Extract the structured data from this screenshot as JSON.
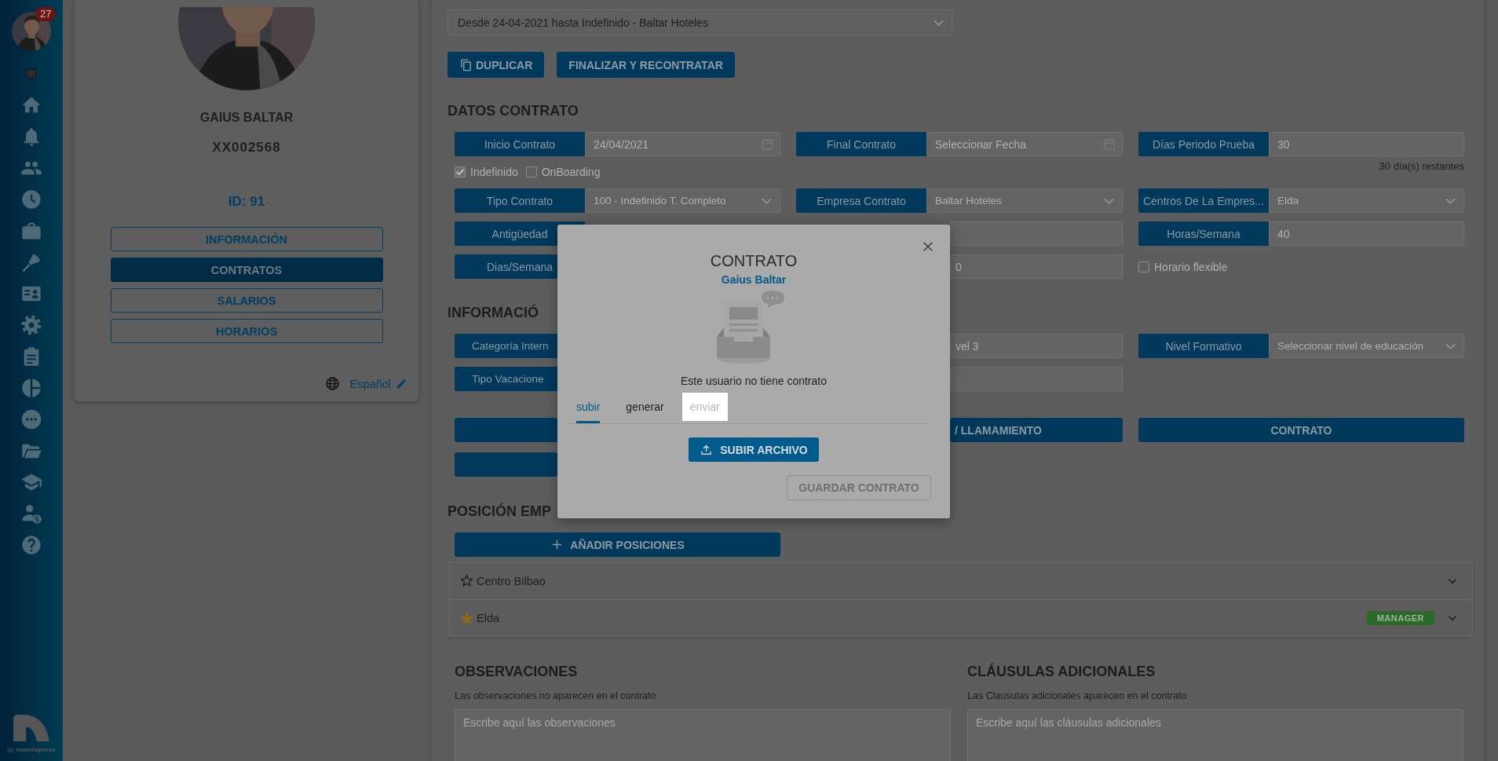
{
  "sidebar": {
    "badge": "27",
    "brand_prefix": "by",
    "brand_name": "nominapress"
  },
  "profile": {
    "name": "GAIUS BALTAR",
    "code": "XX002568",
    "id_label": "ID: 91",
    "tabs": [
      {
        "label": "INFORMACIÓN",
        "selected": false
      },
      {
        "label": "CONTRATOS",
        "selected": true
      },
      {
        "label": "SALARIOS",
        "selected": false
      },
      {
        "label": "HORARIOS",
        "selected": false
      }
    ],
    "language": "Español"
  },
  "contract_select": {
    "value": "Desde 24-04-2021 hasta Indefinido - Baltar Hoteles"
  },
  "actions": [
    {
      "label": "DUPLICAR",
      "kind": "copy"
    },
    {
      "label": "FINALIZAR Y RECONTRATAR",
      "kind": "plain"
    }
  ],
  "datos_contrato": {
    "title": "DATOS CONTRATO",
    "rows": [
      [
        {
          "kind": "date",
          "label": "Inicio Contrato",
          "value": "24/04/2021"
        },
        {
          "kind": "date",
          "label": "Final Contrato",
          "placeholder": "Seleccionar Fecha"
        },
        {
          "kind": "input",
          "label": "Días Periodo Prueba",
          "value": "30"
        }
      ],
      [
        {
          "kind": "checks",
          "checks": [
            {
              "label": "Indefinido",
              "checked": true
            },
            {
              "label": "OnBoarding",
              "checked": false
            }
          ]
        },
        {
          "kind": "empty"
        },
        {
          "kind": "note",
          "text": "30 día(s) restantes"
        }
      ],
      [
        {
          "kind": "select",
          "label": "Tipo Contrato",
          "value": "100 - Indefinido T. Completo"
        },
        {
          "kind": "select",
          "label": "Empresa Contrato",
          "value": "Baltar Hoteles"
        },
        {
          "kind": "select",
          "label": "Centros De La Empres...",
          "value": "Elda"
        }
      ],
      [
        {
          "kind": "label",
          "label": "Antigüedad"
        },
        {
          "kind": "field"
        },
        {
          "kind": "input",
          "label": "Horas/Semana",
          "value": "40"
        }
      ],
      [
        {
          "kind": "label",
          "label": "Dias/Semana"
        },
        {
          "kind": "field",
          "value": "0"
        },
        {
          "kind": "checks",
          "checks": [
            {
              "label": "Horario flexible",
              "checked": false
            }
          ]
        }
      ]
    ]
  },
  "informacion": {
    "title": "INFORMACIÓ",
    "rows": [
      [
        {
          "kind": "label",
          "label": "Categoría Intern"
        },
        {
          "kind": "field",
          "value": "vel 3"
        },
        {
          "kind": "select",
          "label": "Nivel Formativo",
          "placeholder": "Seleccionar nivel de educación"
        }
      ],
      [
        {
          "kind": "label",
          "label": "Tipo Vacacione"
        },
        {
          "kind": "field"
        },
        {
          "kind": "empty"
        }
      ]
    ],
    "buttons": [
      [
        {
          "kind": "blank"
        },
        {
          "kind": "cut",
          "label": "/ LLAMAMIENTO"
        },
        {
          "kind": "full",
          "label": "CONTRATO"
        }
      ],
      [
        {
          "kind": "blank"
        }
      ]
    ]
  },
  "positions": {
    "title": "POSICIÓN EMP",
    "add_button": "AÑADIR POSICIONES",
    "items": [
      {
        "name": "Centro Bilbao",
        "starred": false
      },
      {
        "name": "Elda",
        "starred": true,
        "badge": "MANAGER"
      }
    ]
  },
  "observaciones": {
    "title": "OBSERVACIONES",
    "note": "Las observaciones no aparecen en el contrato",
    "placeholder": "Escribe aquí las observaciones"
  },
  "clausulas": {
    "title": "CLÁUSULAS ADICIONALES",
    "note": "Las Clausulas adicionales aparecen en el contrato",
    "placeholder": "Escribe aquí las cláusulas adicionales"
  },
  "modal": {
    "title": "CONTRATO",
    "subtitle": "Gaius Baltar",
    "message": "Este usuario no tiene contrato",
    "tabs": [
      {
        "label": "subir",
        "selected": true,
        "disabled": false
      },
      {
        "label": "generar",
        "selected": false,
        "disabled": false
      },
      {
        "label": "enviar",
        "selected": false,
        "disabled": true
      }
    ],
    "upload_button": "SUBIR ARCHIVO",
    "save_button": {
      "label": "GUARDAR CONTRATO",
      "disabled": true
    }
  }
}
